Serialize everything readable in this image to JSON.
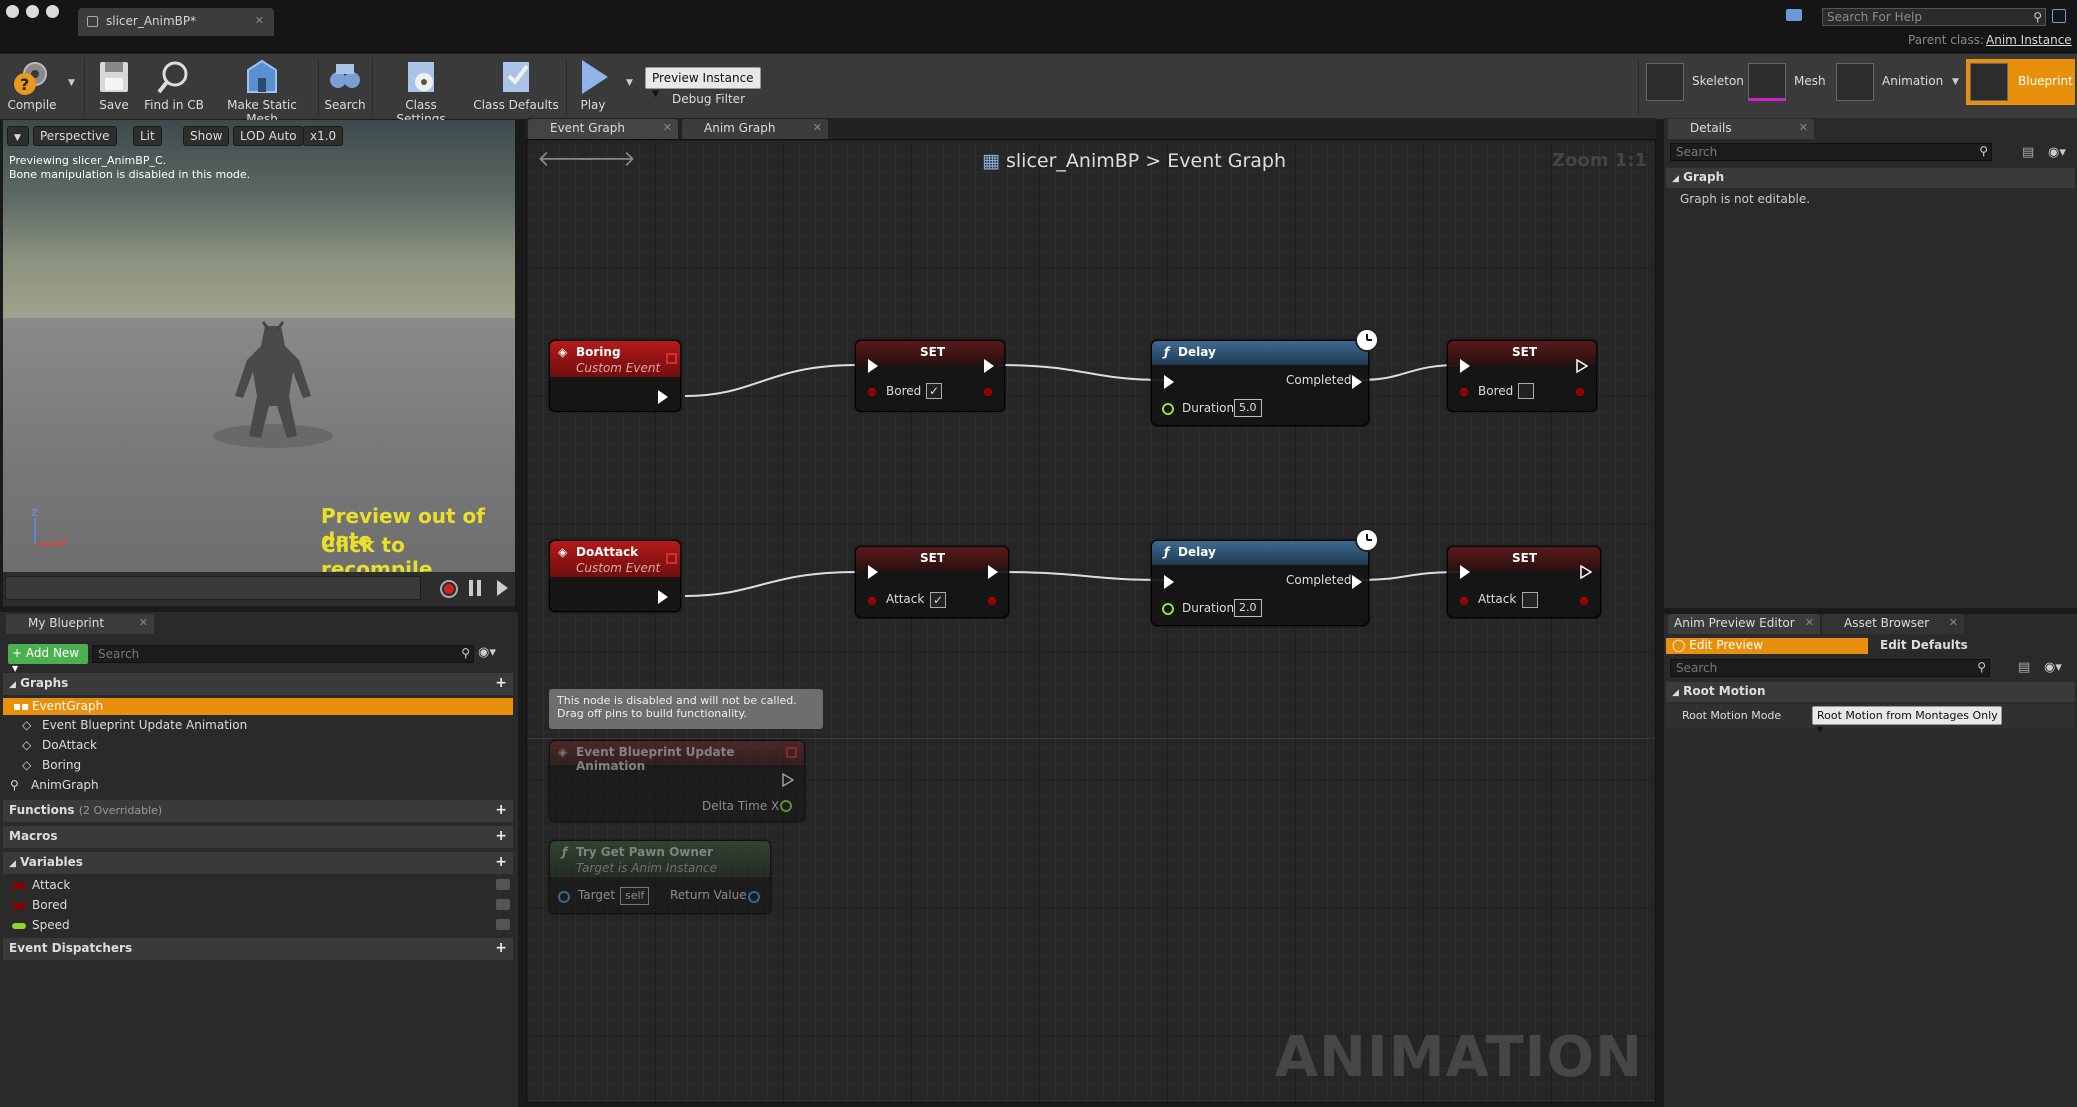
{
  "window": {
    "doc_tab": "slicer_AnimBP*",
    "help_search_placeholder": "Search For Help",
    "parent_class_label": "Parent class:",
    "parent_class_value": "Anim Instance"
  },
  "toolbar": {
    "compile": "Compile",
    "save": "Save",
    "find_in_cb": "Find in CB",
    "make_static_mesh": "Make Static Mesh",
    "search": "Search",
    "class_settings": "Class Settings",
    "class_defaults": "Class Defaults",
    "play": "Play",
    "preview_instance": "Preview Instance",
    "debug_filter": "Debug Filter"
  },
  "modes": {
    "skeleton": "Skeleton",
    "mesh": "Mesh",
    "animation": "Animation",
    "blueprint": "Blueprint",
    "active": "Blueprint",
    "active_color": "#e8900c"
  },
  "viewport": {
    "perspective": "Perspective",
    "lit": "Lit",
    "show": "Show",
    "lod": "LOD Auto",
    "speed": "x1.0",
    "info1": "Previewing slicer_AnimBP_C.",
    "info2": "Bone manipulation is disabled in this mode.",
    "out_of_date_1": "Preview out of date",
    "out_of_date_2": "Click to recompile",
    "axis_z": "Z",
    "axis_x": "X"
  },
  "my_blueprint": {
    "tab": "My Blueprint",
    "add_new": "Add New",
    "search_placeholder": "Search",
    "sections": {
      "graphs": "Graphs",
      "functions": "Functions",
      "functions_note": "(2 Overridable)",
      "macros": "Macros",
      "variables": "Variables",
      "event_dispatchers": "Event Dispatchers"
    },
    "graph_items": {
      "event_graph": "EventGraph",
      "ebua": "Event Blueprint Update Animation",
      "do_attack": "DoAttack",
      "boring": "Boring",
      "anim_graph": "AnimGraph"
    },
    "variables": [
      {
        "name": "Attack",
        "color": "#8a0000"
      },
      {
        "name": "Bored",
        "color": "#8a0000"
      },
      {
        "name": "Speed",
        "color": "#8fd42a"
      }
    ]
  },
  "graph_editor": {
    "tabs": {
      "event_graph": "Event Graph",
      "anim_graph": "Anim Graph"
    },
    "breadcrumb_bp": "slicer_AnimBP",
    "breadcrumb_sep": ">",
    "breadcrumb_graph": "Event Graph",
    "zoom": "Zoom 1:1",
    "watermark": "ANIMATION",
    "nodes": {
      "boring_title": "Boring",
      "boring_sub": "Custom Event",
      "set1_title": "SET",
      "set1_var": "Bored",
      "delay1_title": "Delay",
      "delay1_completed": "Completed",
      "delay1_duration": "Duration",
      "delay1_value": "5.0",
      "set2_title": "SET",
      "set2_var": "Bored",
      "doattack_title": "DoAttack",
      "doattack_sub": "Custom Event",
      "set3_title": "SET",
      "set3_var": "Attack",
      "delay2_title": "Delay",
      "delay2_completed": "Completed",
      "delay2_duration": "Duration",
      "delay2_value": "2.0",
      "set4_title": "SET",
      "set4_var": "Attack",
      "disabled_note_1": "This node is disabled and will not be called.",
      "disabled_note_2": "Drag off pins to build functionality.",
      "ebua_title": "Event Blueprint Update Animation",
      "ebua_pin": "Delta Time X",
      "tgpo_title": "Try Get Pawn Owner",
      "tgpo_sub": "Target is Anim Instance",
      "tgpo_target": "Target",
      "tgpo_self": "self",
      "tgpo_return": "Return Value"
    }
  },
  "details": {
    "tab": "Details",
    "search_placeholder": "Search",
    "section": "Graph",
    "message": "Graph is not editable."
  },
  "anim_preview": {
    "tab1": "Anim Preview Editor",
    "tab2": "Asset Browser",
    "edit_preview": "Edit Preview",
    "edit_defaults": "Edit Defaults",
    "search_placeholder": "Search",
    "section": "Root Motion",
    "field_label": "Root Motion Mode",
    "field_value": "Root Motion from Montages Only"
  }
}
